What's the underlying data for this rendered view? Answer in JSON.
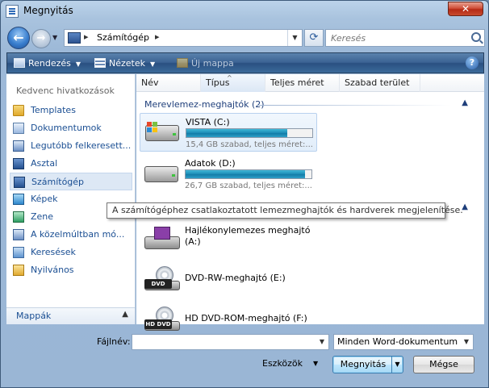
{
  "window": {
    "title": "Megnyitás",
    "close_label": "✕"
  },
  "nav": {
    "address_location": "Számítógép",
    "search_placeholder": "Keresés"
  },
  "toolbar": {
    "organize_label": "Rendezés",
    "views_label": "Nézetek",
    "new_folder_label": "Új mappa",
    "help_label": "?"
  },
  "sidebar": {
    "header": "Kedvenc hivatkozások",
    "items": [
      {
        "label": "Templates",
        "icon": "folder-icon"
      },
      {
        "label": "Dokumentumok",
        "icon": "documents-icon"
      },
      {
        "label": "Legutóbb felkeresett...",
        "icon": "recent-places-icon"
      },
      {
        "label": "Asztal",
        "icon": "desktop-icon"
      },
      {
        "label": "Számítógép",
        "icon": "computer-icon",
        "selected": true
      },
      {
        "label": "Képek",
        "icon": "pictures-icon"
      },
      {
        "label": "Zene",
        "icon": "music-icon"
      },
      {
        "label": "A közelmúltban mó...",
        "icon": "recently-changed-icon"
      },
      {
        "label": "Keresések",
        "icon": "searches-icon"
      },
      {
        "label": "Nyilvános",
        "icon": "public-folder-icon"
      }
    ],
    "folders_label": "Mappák"
  },
  "columns": [
    "Név",
    "Típus",
    "Teljes méret",
    "Szabad terület"
  ],
  "groups": {
    "hard_drives": "Merevlemez-meghajtók (2)"
  },
  "drives": [
    {
      "name": "VISTA (C:)",
      "detail": "15,4 GB szabad, teljes méret:...",
      "used_fraction": 0.8,
      "selected": true
    },
    {
      "name": "Adatok (D:)",
      "detail": "26,7 GB szabad, teljes méret:...",
      "used_fraction": 0.95,
      "selected": false
    }
  ],
  "removable": [
    {
      "name": "Hajlékonylemezes meghajtó",
      "sub": "(A:)",
      "icon": "floppy-drive-icon"
    },
    {
      "name": "DVD-RW-meghajtó (E:)",
      "sub": "",
      "icon": "dvd-drive-icon",
      "disc_label": "DVD"
    },
    {
      "name": "HD DVD-ROM-meghajtó (F:)",
      "sub": "",
      "icon": "hd-dvd-drive-icon",
      "disc_label": "HD DVD"
    }
  ],
  "tooltip": "A számítógéphez csatlakoztatott lemezmeghajtók és hardverek megjelenítése.",
  "bottom": {
    "filename_label": "Fájlnév:",
    "filename_value": "",
    "filetype": "Minden Word-dokumentum",
    "tools_label": "Eszközök",
    "open_label": "Megnyitás",
    "cancel_label": "Mégse"
  }
}
